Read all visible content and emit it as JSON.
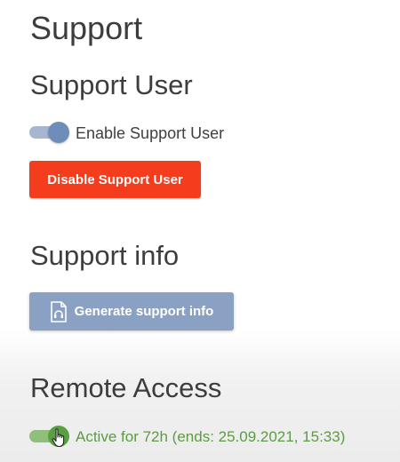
{
  "page": {
    "title": "Support"
  },
  "support_user": {
    "title": "Support User",
    "toggle_label": "Enable Support User",
    "toggle_on": true,
    "disable_button": "Disable Support User"
  },
  "support_info": {
    "title": "Support info",
    "generate_button": "Generate support info",
    "generate_icon": "file-support-icon"
  },
  "remote_access": {
    "title": "Remote Access",
    "toggle_on": true,
    "status": "Active for 72h (ends: 25.09.2021, 15:33)"
  },
  "colors": {
    "danger": "#f43d1c",
    "primary": "#8aa1c4",
    "success": "#5e9a45"
  }
}
